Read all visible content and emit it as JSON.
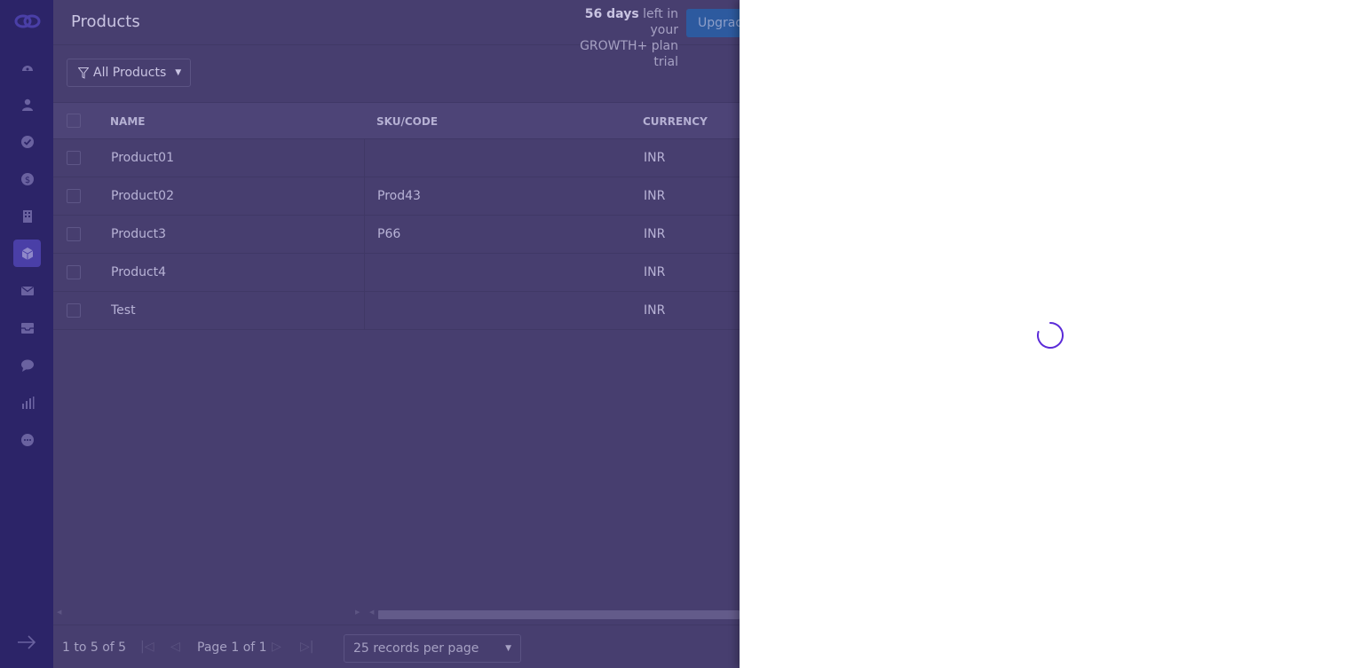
{
  "sidebar": {
    "items": [
      {
        "icon": "dashboard-icon"
      },
      {
        "icon": "person-icon"
      },
      {
        "icon": "check-circle-icon"
      },
      {
        "icon": "dollar-icon"
      },
      {
        "icon": "building-icon"
      },
      {
        "icon": "cube-icon",
        "active": true
      },
      {
        "icon": "mail-icon"
      },
      {
        "icon": "inbox-icon"
      },
      {
        "icon": "chat-icon"
      },
      {
        "icon": "bar-chart-icon"
      },
      {
        "icon": "more-icon"
      }
    ]
  },
  "header": {
    "title": "Products",
    "trial_days": "56 days",
    "trial_rest1": " left in your",
    "trial_line2": "GROWTH+ plan trial",
    "upgrade_label": "Upgrade"
  },
  "filter": {
    "label": "All Products"
  },
  "table": {
    "columns": [
      "NAME",
      "SKU/CODE",
      "CURRENCY"
    ],
    "rows": [
      {
        "name": "Product01",
        "sku": "",
        "currency": "INR"
      },
      {
        "name": "Product02",
        "sku": "Prod43",
        "currency": "INR"
      },
      {
        "name": "Product3",
        "sku": "P66",
        "currency": "INR"
      },
      {
        "name": "Product4",
        "sku": "",
        "currency": "INR"
      },
      {
        "name": "Test",
        "sku": "",
        "currency": "INR"
      }
    ]
  },
  "pagination": {
    "range": "1 to 5 of 5",
    "page": "Page 1 of 1",
    "per_page": "25 records per page"
  },
  "colors": {
    "sidebar": "#2c2468",
    "overlay": "#473e6f",
    "spinner": "#5b2bd8",
    "panel": "#ffffff"
  }
}
